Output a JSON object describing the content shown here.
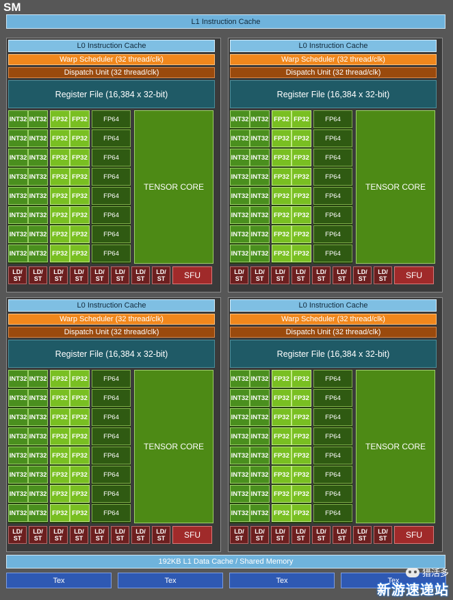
{
  "sm_label": "SM",
  "l1_instruction_cache": "L1 Instruction Cache",
  "subpartition": {
    "l0_cache": "L0 Instruction Cache",
    "warp_scheduler": "Warp Scheduler (32 thread/clk)",
    "dispatch_unit": "Dispatch Unit (32 thread/clk)",
    "register_file": "Register File (16,384 x 32-bit)",
    "int32_label": "INT32",
    "fp32_label": "FP32",
    "fp64_label": "FP64",
    "tensor_core": "TENSOR CORE",
    "ldst_label": "LD/\nST",
    "sfu": "SFU"
  },
  "l1_data_cache": "192KB L1 Data Cache / Shared Memory",
  "tex_units": [
    "Tex",
    "Tex",
    "Tex",
    "Tex"
  ],
  "watermark": {
    "top": "猎活多",
    "bottom": "新游速递站"
  },
  "colors": {
    "background": "#575757",
    "cache": "#6fb3dc",
    "warp": "#f0871c",
    "dispatch": "#9a4a0d",
    "register": "#1f5a66",
    "int32": "#4a8f1e",
    "fp32": "#79bf22",
    "fp64": "#2f5a12",
    "tensor": "#4d8a15",
    "ldst": "#6c1f1f",
    "sfu": "#a02a2a",
    "tex": "#2e59b3"
  }
}
